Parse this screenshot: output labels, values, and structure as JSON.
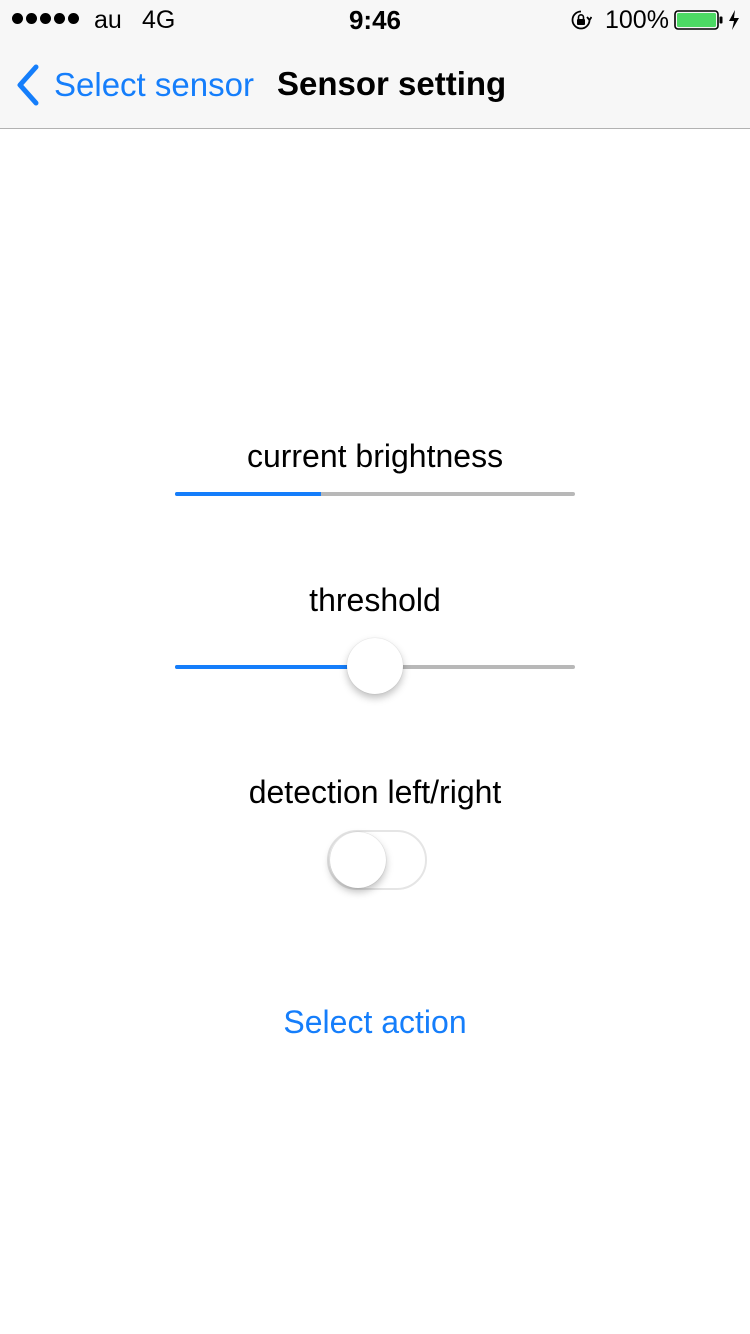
{
  "status_bar": {
    "carrier": "au",
    "network": "4G",
    "time": "9:46",
    "battery_percent": "100%",
    "signal_bars": 5,
    "icons": [
      "signal-dots-icon",
      "orientation-lock-icon",
      "battery-icon",
      "charging-icon"
    ]
  },
  "nav": {
    "back_label": "Select sensor",
    "title": "Sensor setting"
  },
  "sensor": {
    "brightness_label": "current brightness",
    "brightness_level": 0.365,
    "threshold_label": "threshold",
    "threshold_value": 0.5,
    "detection_label": "detection left/right",
    "detection_enabled": false
  },
  "action": {
    "label": "Select action"
  },
  "colors": {
    "accent": "#157efb",
    "track": "#b8b8b8",
    "bar_background": "#f7f7f7",
    "battery": "#4cd964"
  }
}
